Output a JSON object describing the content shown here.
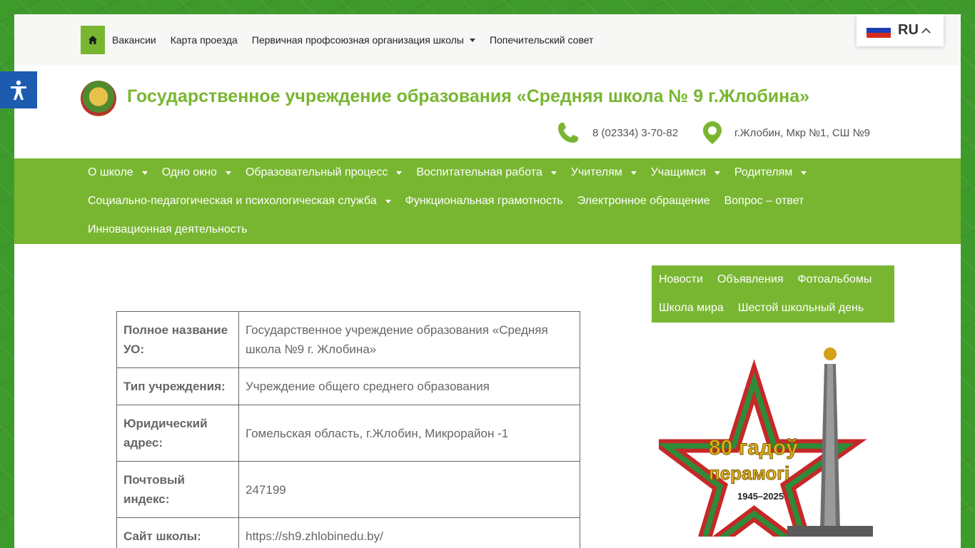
{
  "colors": {
    "accent": "#78b631",
    "accessibility": "#1c5bb0"
  },
  "topbar": {
    "home_icon": "home-icon",
    "items": [
      {
        "label": "Вакансии",
        "dropdown": false
      },
      {
        "label": "Карта проезда",
        "dropdown": false
      },
      {
        "label": "Первичная профсоюзная организация школы",
        "dropdown": true
      },
      {
        "label": "Попечительский совет",
        "dropdown": false
      }
    ]
  },
  "language": {
    "code": "RU",
    "flag_icon": "russia-flag-icon"
  },
  "header": {
    "title": "Государственное учреждение образования «Средняя школа № 9 г.Жлобина»",
    "phone": "8 (02334) 3-70-82",
    "address": "г.Жлобин, Мкр №1, СШ №9"
  },
  "mainnav": {
    "row1": [
      {
        "label": "О школе",
        "dropdown": true
      },
      {
        "label": "Одно окно",
        "dropdown": true
      },
      {
        "label": "Образовательный процесс",
        "dropdown": true
      },
      {
        "label": "Воспитательная работа",
        "dropdown": true
      },
      {
        "label": "Учителям",
        "dropdown": true
      },
      {
        "label": "Учащимся",
        "dropdown": true
      },
      {
        "label": "Родителям",
        "dropdown": true
      }
    ],
    "row2": [
      {
        "label": "Социально-педагогическая и психологическая служба",
        "dropdown": true
      },
      {
        "label": "Функциональная грамотность",
        "dropdown": false
      },
      {
        "label": "Электронное обращение",
        "dropdown": false
      },
      {
        "label": "Вопрос – ответ",
        "dropdown": false
      }
    ],
    "row3": [
      {
        "label": "Инновационная деятельность",
        "dropdown": false
      }
    ]
  },
  "info_table": [
    {
      "key": "Полное название УО:",
      "value": "Государственное учреждение образования «Средняя школа №9 г. Жлобина»"
    },
    {
      "key": "Тип учреждения:",
      "value": "Учреждение общего среднего образования"
    },
    {
      "key": "Юридический адрес:",
      "value": "Гомельская область,  г.Жлобин, Микрорайон -1"
    },
    {
      "key": "Почтовый индекс:",
      "value": "247199"
    },
    {
      "key": "Сайт школы:",
      "value": "https://sh9.zhlobinedu.by/"
    }
  ],
  "side_menu": {
    "row1": [
      "Новости",
      "Объявления",
      "Фотоальбомы"
    ],
    "row2": [
      "Школа мира",
      "Шестой школьный день"
    ]
  },
  "victory_banner": {
    "line1": "80 гадоў",
    "line2": "перамогі",
    "years": "1945–2025"
  }
}
